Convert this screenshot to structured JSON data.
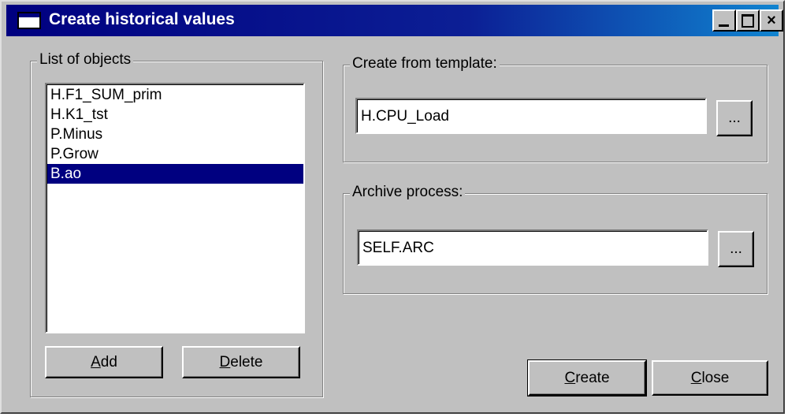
{
  "window": {
    "title": "Create historical values",
    "minimize_label": "_",
    "maximize_label": "□",
    "close_label": "×"
  },
  "objects_group": {
    "legend": "List of objects",
    "items": [
      {
        "label": "H.F1_SUM_prim",
        "selected": false
      },
      {
        "label": "H.K1_tst",
        "selected": false
      },
      {
        "label": "P.Minus",
        "selected": false
      },
      {
        "label": "P.Grow",
        "selected": false
      },
      {
        "label": "B.ao",
        "selected": true
      }
    ],
    "add_mnemonic": "A",
    "add_rest": "dd",
    "delete_mnemonic": "D",
    "delete_rest": "elete"
  },
  "template_group": {
    "legend": "Create from template:",
    "value": "H.CPU_Load",
    "browse_label": "..."
  },
  "archive_group": {
    "legend": "Archive process:",
    "value": "SELF.ARC",
    "browse_label": "..."
  },
  "actions": {
    "create_mnemonic": "C",
    "create_rest": "reate",
    "close_mnemonic": "C",
    "close_rest": "lose"
  }
}
